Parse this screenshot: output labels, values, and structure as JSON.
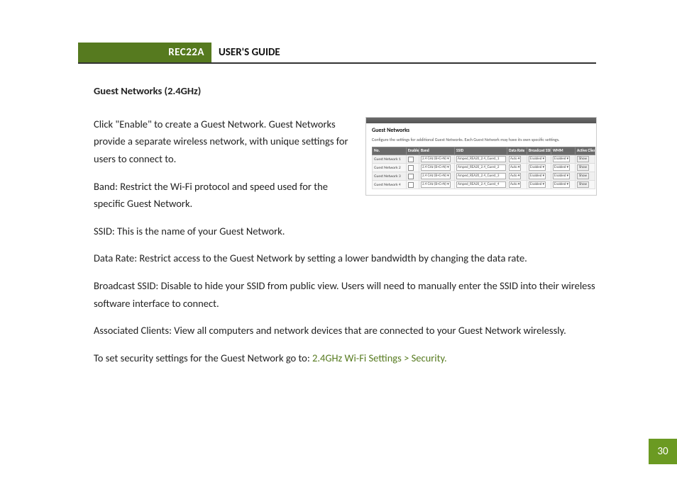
{
  "header": {
    "model": "REC22A",
    "title": "USER'S GUIDE"
  },
  "section_title": "Guest Networks (2.4GHz)",
  "paragraphs": {
    "p1": "Click \"Enable\" to create a Guest Network. Guest Networks provide a separate wireless network, with unique settings for users to connect to.",
    "p2": "Band: Restrict the Wi-Fi protocol and speed used for the specific Guest Network.",
    "p3": "SSID: This is the name of your Guest Network.",
    "p4": "Data Rate: Restrict access to the Guest Network by setting a lower bandwidth by changing the data rate.",
    "p5": "Broadcast SSID: Disable to hide your SSID from public view. Users will need to manually enter the SSID into their wireless software interface to connect.",
    "p6": "Associated Clients: View all computers and network devices that are connected to your Guest Network wirelessly.",
    "p7_prefix": "To set security settings for the Guest Network go to: ",
    "p7_link": "2.4GHz Wi-Fi Settings > Security."
  },
  "screenshot": {
    "title": "Guest Networks",
    "desc": "Configure the settings for additional Guest Networks. Each Guest Network may have its own specific settings.",
    "columns": {
      "c0": "No.",
      "c1": "Enable",
      "c2": "Band",
      "c3": "SSID",
      "c4": "Data Rate",
      "c5": "Broadcast SSID",
      "c6": "WMM",
      "c7": "Active Client List"
    },
    "band_value": "2.4 GHz (B+G+N)",
    "rate_value": "Auto",
    "bcast_value": "Enabled",
    "wmm_value": "Enabled",
    "btn_label": "Show",
    "rows": [
      {
        "no": "Guest Network 1",
        "ssid": "Amped_REA20_2.4_Guest_1"
      },
      {
        "no": "Guest Network 2",
        "ssid": "Amped_REA20_2.4_Guest_2"
      },
      {
        "no": "Guest Network 3",
        "ssid": "Amped_REA20_2.4_Guest_3"
      },
      {
        "no": "Guest Network 4",
        "ssid": "Amped_REA20_2.4_Guest_4"
      }
    ]
  },
  "page_number": "30"
}
